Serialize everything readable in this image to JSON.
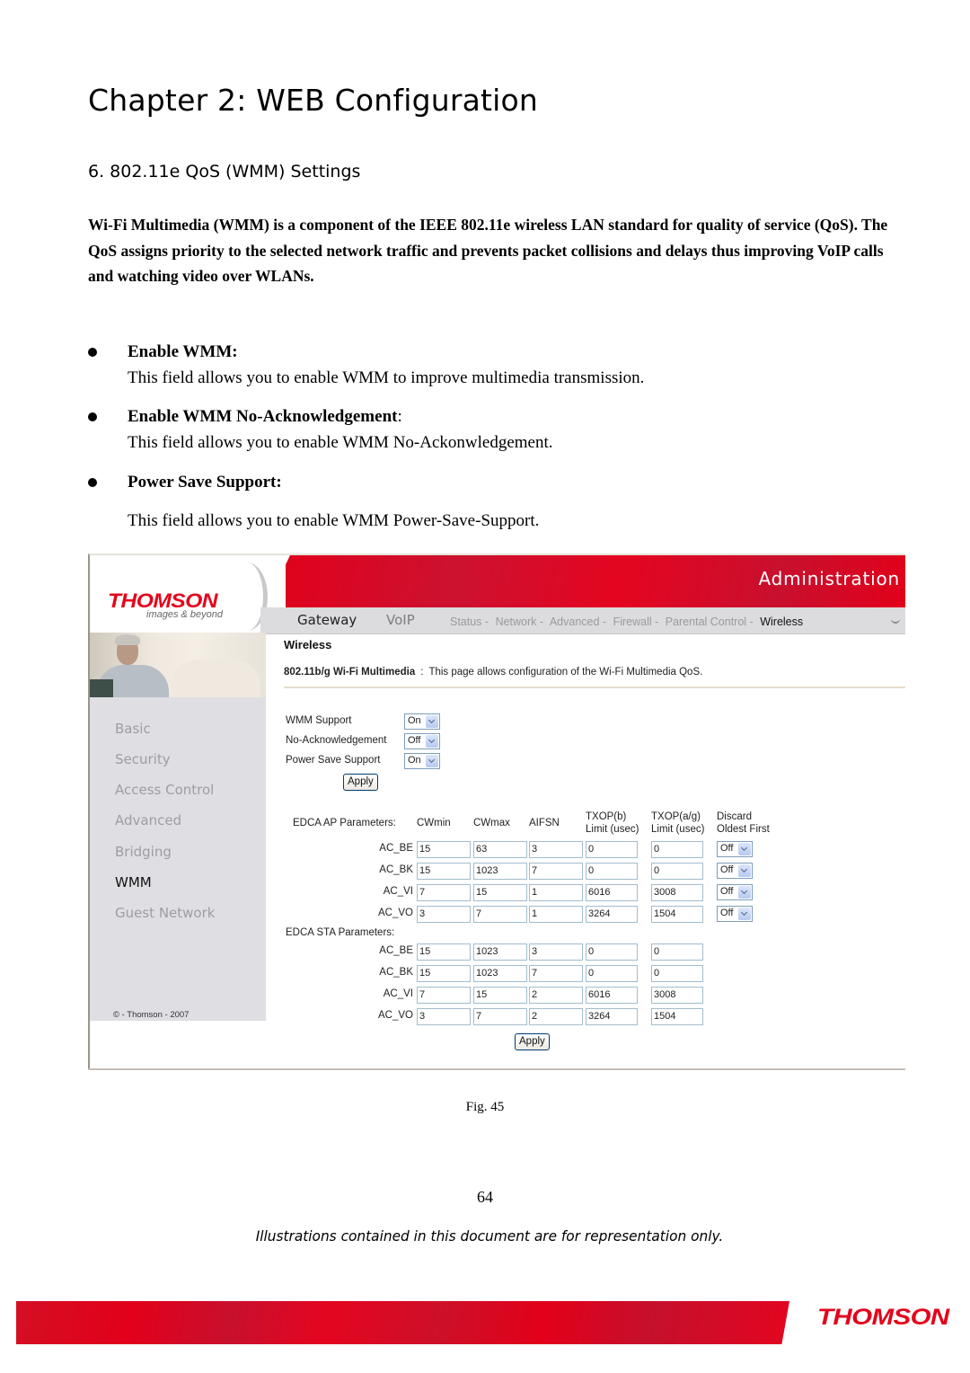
{
  "document": {
    "chapter_title": "Chapter 2: WEB Configuration",
    "section_title": "6. 802.11e QoS (WMM) Settings",
    "intro": "Wi-Fi Multimedia (WMM) is a component of the IEEE 802.11e wireless LAN standard for quality of service (QoS). The QoS assigns priority to the selected network traffic and prevents packet collisions and delays thus improving VoIP calls and watching video over WLANs.",
    "bullets": [
      {
        "label": "Enable WMM:",
        "suffix": "",
        "description": "This field allows you to enable WMM to improve multimedia transmission."
      },
      {
        "label": "Enable WMM No-Acknowledgement",
        "suffix": ":",
        "description": "This field allows you to enable WMM No-Ackonwledgement."
      },
      {
        "label": "Power Save Support:",
        "suffix": "",
        "description": "This field allows you to enable WMM Power-Save-Support."
      }
    ],
    "figure_caption": "Fig. 45",
    "page_number": "64",
    "disclaimer": "Illustrations contained in this document are for representation only.",
    "footer_logo": "THOMSON"
  },
  "screenshot": {
    "logo": "THOMSON",
    "tagline": "images & beyond",
    "banner_title": "Administration",
    "nav_main": [
      "Gateway",
      "VoIP"
    ],
    "nav_sub": [
      "Status -",
      "Network -",
      "Advanced -",
      "Firewall -",
      "Parental Control -",
      "Wireless"
    ],
    "nav_sub_active": "Wireless",
    "sidebar": {
      "items": [
        "Basic",
        "Security",
        "Access Control",
        "Advanced",
        "Bridging",
        "WMM",
        "Guest Network"
      ],
      "active": "WMM",
      "copyright": "© - Thomson - 2007"
    },
    "page_heading": "Wireless",
    "page_desc_title": "802.11b/g Wi-Fi Multimedia",
    "page_desc_sep": ":",
    "page_desc": "This page allows configuration of the Wi-Fi Multimedia QoS.",
    "wmm_settings": [
      {
        "label": "WMM Support",
        "value": "On"
      },
      {
        "label": "No-Acknowledgement",
        "value": "Off"
      },
      {
        "label": "Power Save Support",
        "value": "On"
      }
    ],
    "apply_label": "Apply",
    "edca_ap": {
      "title": "EDCA AP Parameters:",
      "columns": [
        "CWmin",
        "CWmax",
        "AIFSN",
        "TXOP(b)",
        "Limit (usec)",
        "TXOP(a/g)",
        "Limit (usec)",
        "Discard",
        "Oldest First"
      ],
      "rows": [
        {
          "ac": "AC_BE",
          "cwmin": "15",
          "cwmax": "63",
          "aifsn": "3",
          "txop_b": "0",
          "txop_ag": "0",
          "discard": "Off"
        },
        {
          "ac": "AC_BK",
          "cwmin": "15",
          "cwmax": "1023",
          "aifsn": "7",
          "txop_b": "0",
          "txop_ag": "0",
          "discard": "Off"
        },
        {
          "ac": "AC_VI",
          "cwmin": "7",
          "cwmax": "15",
          "aifsn": "1",
          "txop_b": "6016",
          "txop_ag": "3008",
          "discard": "Off"
        },
        {
          "ac": "AC_VO",
          "cwmin": "3",
          "cwmax": "7",
          "aifsn": "1",
          "txop_b": "3264",
          "txop_ag": "1504",
          "discard": "Off"
        }
      ]
    },
    "edca_sta": {
      "title": "EDCA STA Parameters:",
      "rows": [
        {
          "ac": "AC_BE",
          "cwmin": "15",
          "cwmax": "1023",
          "aifsn": "3",
          "txop_b": "0",
          "txop_ag": "0"
        },
        {
          "ac": "AC_BK",
          "cwmin": "15",
          "cwmax": "1023",
          "aifsn": "7",
          "txop_b": "0",
          "txop_ag": "0"
        },
        {
          "ac": "AC_VI",
          "cwmin": "7",
          "cwmax": "15",
          "aifsn": "2",
          "txop_b": "6016",
          "txop_ag": "3008"
        },
        {
          "ac": "AC_VO",
          "cwmin": "3",
          "cwmax": "7",
          "aifsn": "2",
          "txop_b": "3264",
          "txop_ag": "1504"
        }
      ]
    }
  },
  "colors": {
    "brand_red": "#e3051b",
    "sidebar_bg": "#dfdee3",
    "nav_bg": "#dcdcdf"
  }
}
